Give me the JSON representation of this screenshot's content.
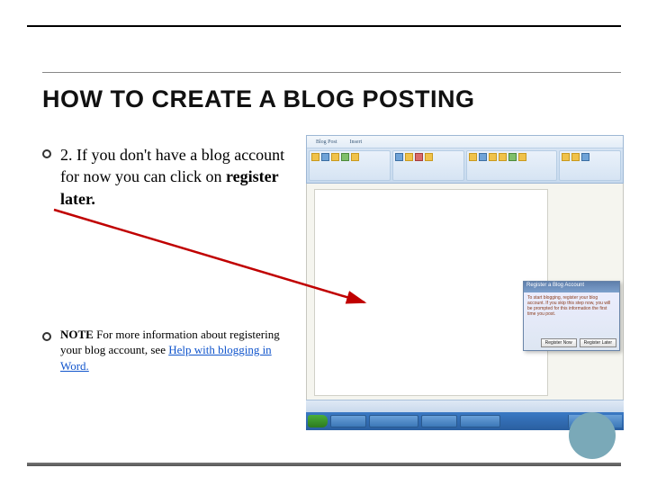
{
  "title": "HOW TO CREATE A BLOG POSTING",
  "bullets": {
    "step2": {
      "prefix": "2. If you don't have a blog account for now you can click on ",
      "bold": "register later."
    },
    "note": {
      "label": "NOTE",
      "text": "   For more information about registering your blog account, see ",
      "link": "Help with blogging in Word."
    }
  },
  "screenshot": {
    "dialog_title": "Register a Blog Account",
    "dialog_body": "To start blogging, register your blog account. If you skip this step now, you will be prompted for this information the first time you post.",
    "dialog_buttons": {
      "register": "Register Now",
      "later": "Register Later"
    }
  }
}
